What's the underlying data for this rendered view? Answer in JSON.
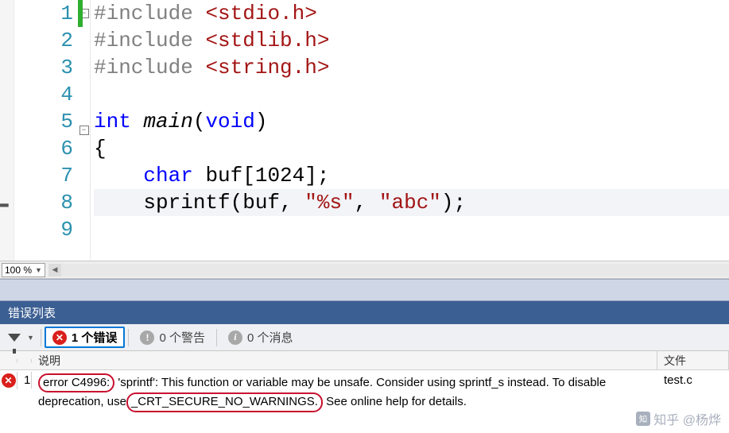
{
  "editor": {
    "zoom": "100 %",
    "lines": [
      {
        "n": 1,
        "fold": "start",
        "mod": true,
        "seg": [
          {
            "t": "#include ",
            "c": "pp"
          },
          {
            "t": "<stdio.h>",
            "c": "str"
          }
        ]
      },
      {
        "n": 2,
        "seg": [
          {
            "t": "#include ",
            "c": "pp"
          },
          {
            "t": "<stdlib.h>",
            "c": "str"
          }
        ]
      },
      {
        "n": 3,
        "seg": [
          {
            "t": "#include ",
            "c": "pp"
          },
          {
            "t": "<string.h>",
            "c": "str"
          }
        ]
      },
      {
        "n": 4,
        "seg": []
      },
      {
        "n": 5,
        "fold": "start",
        "seg": [
          {
            "t": "int ",
            "c": "kw"
          },
          {
            "t": "main",
            "c": "ident-it"
          },
          {
            "t": "(",
            "c": "plain"
          },
          {
            "t": "void",
            "c": "kw"
          },
          {
            "t": ")",
            "c": "plain"
          }
        ]
      },
      {
        "n": 6,
        "seg": [
          {
            "t": "{",
            "c": "plain"
          }
        ]
      },
      {
        "n": 7,
        "seg": [
          {
            "t": "    ",
            "c": "plain"
          },
          {
            "t": "char",
            "c": "kw"
          },
          {
            "t": " buf[1024];",
            "c": "plain"
          }
        ]
      },
      {
        "n": 8,
        "hl": true,
        "mark": "arrow",
        "seg": [
          {
            "t": "    sprintf(buf, ",
            "c": "plain"
          },
          {
            "t": "\"%s\"",
            "c": "str"
          },
          {
            "t": ", ",
            "c": "plain"
          },
          {
            "t": "\"abc\"",
            "c": "str"
          },
          {
            "t": ");",
            "c": "plain"
          }
        ]
      },
      {
        "n": 9,
        "seg": []
      }
    ]
  },
  "panel": {
    "title": "错误列表",
    "tabs": {
      "errors": "1 个错误",
      "warnings": "0 个警告",
      "messages": "0 个消息"
    },
    "columns": {
      "desc": "说明",
      "file": "文件"
    },
    "rows": [
      {
        "n": "1",
        "pre": "error C4996:",
        "mid1": " 'sprintf': This function or variable may be unsafe. Consider using sprintf_s instead. To disable deprecation, use",
        "circ": " _CRT_SECURE_NO_WARNINGS.",
        "mid2": " See online help for details.",
        "file": "test.c"
      }
    ]
  },
  "watermark": "知乎 @杨烨"
}
